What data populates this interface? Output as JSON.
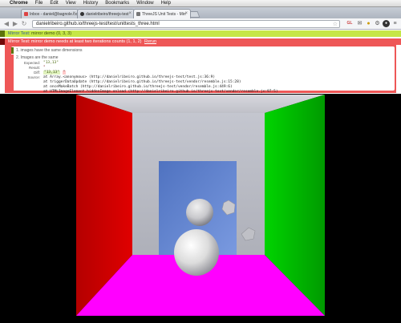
{
  "menubar": {
    "app_name": "Chrome",
    "items": [
      "File",
      "Edit",
      "View",
      "History",
      "Bookmarks",
      "Window",
      "Help"
    ]
  },
  "tabs": [
    {
      "label": "Inbox - daniel@bagnole.co"
    },
    {
      "label": "danielribeiro/threejs-test"
    },
    {
      "label": "ThreeJS Unit Tests - Mirr"
    }
  ],
  "toolbar": {
    "url": "danielribeiro.github.io/threejs-test/test/unittests_three.html",
    "ext_gl": "GL"
  },
  "results": {
    "pass_test": {
      "prefix": "Mirror Test:",
      "name": "mirror demo",
      "counts": "(0, 3, 3)"
    },
    "fail_test": {
      "text": "Mirror Test: mirror demo needs at least two iterations counts (1, 1, 2)",
      "rerun": "Rerun"
    },
    "assertions": [
      {
        "text": "1. images have the same dimensions"
      },
      {
        "text": "2. Images are the same"
      }
    ],
    "table": {
      "expected_label": "Expected:",
      "expected_value": "\"13,13\"",
      "result_label": "Result:",
      "result_value": "\"",
      "diff_label": "Diff:",
      "diff_old": "\"13,13\"",
      "diff_new": "\"",
      "source_label": "Source:",
      "source_lines": [
        "at Array.<anonymous> (http://danielribeiro.github.io/threejs-test/test.js:36:9)",
        "at triggerDataUpdate (http://danielribeiro.github.io/threejs-test/vendor/resemble.js:15:28)",
        "at onceMakeBatch (http://danielribeiro.github.io/threejs-test/vendor/resemble.js:449:6)",
        "at HTMLImageElement.hiddenImage.onload (http://danielribeiro.github.io/threejs-test/vendor/resemble.js:97:5)"
      ]
    }
  },
  "colors": {
    "left_wall": "#cc0000",
    "right_wall": "#00bb00",
    "floor": "#ff00ff",
    "back_panel": "#5a7fd0",
    "pass_green": "#c6e746",
    "fail_red": "#ee5757"
  }
}
